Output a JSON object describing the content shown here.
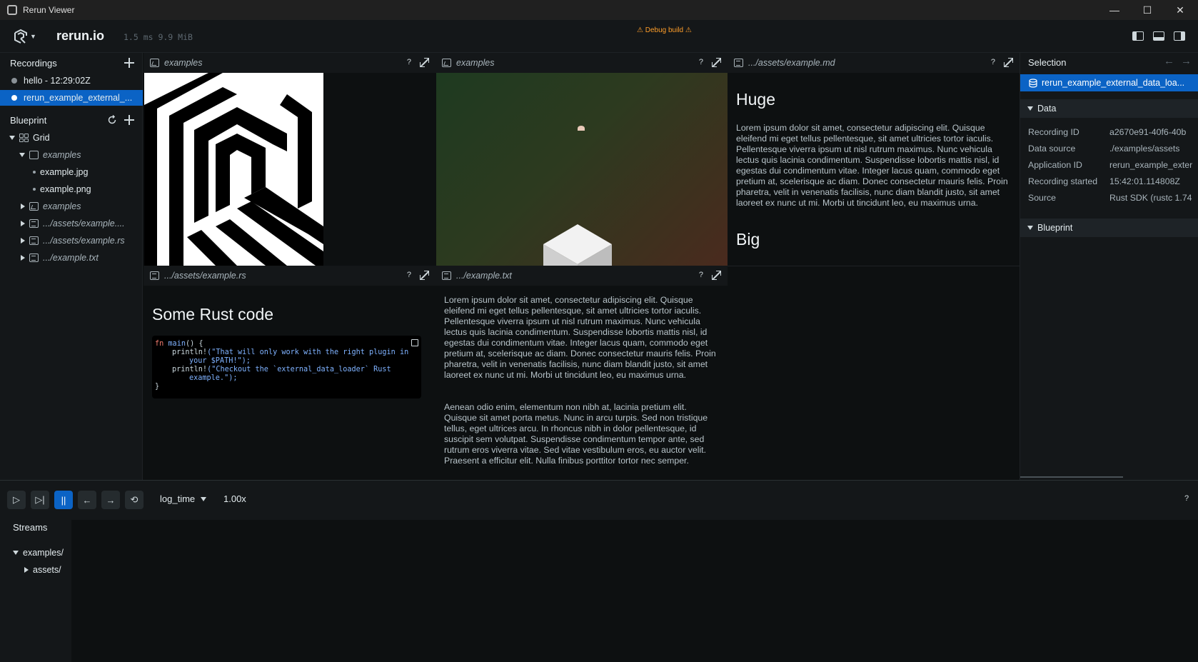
{
  "window": {
    "title": "Rerun Viewer",
    "controls": [
      "—",
      "☐",
      "✕"
    ]
  },
  "top": {
    "brand": "rerun.io",
    "stats": "1.5 ms 9.9 MiB",
    "debug_badge": "⚠ Debug build ⚠"
  },
  "recordings": {
    "header": "Recordings",
    "items": [
      {
        "label": "hello - 12:29:02Z",
        "selected": false
      },
      {
        "label": "rerun_example_external_...",
        "selected": true
      }
    ]
  },
  "blueprint": {
    "header": "Blueprint",
    "tree": {
      "grid": "Grid",
      "examples_1": "examples",
      "example_jpg": "example.jpg",
      "example_png": "example.png",
      "examples_2": "examples",
      "assets_md": ".../assets/example....",
      "assets_rs": ".../assets/example.rs",
      "example_txt": ".../example.txt"
    }
  },
  "views": {
    "v1": {
      "title": "examples",
      "help": "?"
    },
    "v2": {
      "title": "examples",
      "help": "?"
    },
    "v3": {
      "title": ".../assets/example.md",
      "help": "?",
      "h1": "Huge",
      "para": "Lorem ipsum dolor sit amet, consectetur adipiscing elit. Quisque eleifend mi eget tellus pellentesque, sit amet ultricies tortor iaculis. Pellentesque viverra ipsum ut nisl rutrum maximus. Nunc vehicula lectus quis lacinia condimentum. Suspendisse lobortis mattis nisl, id egestas dui condimentum vitae. Integer lacus quam, commodo eget pretium at, scelerisque ac diam. Donec consectetur mauris felis. Proin pharetra, velit in venenatis facilisis, nunc diam blandit justo, sit amet laoreet ex nunc ut mi. Morbi ut tincidunt leo, eu maximus urna.",
      "h2": "Big"
    },
    "v4": {
      "title": ".../assets/example.rs",
      "help": "?",
      "h1": "Some Rust code",
      "code": {
        "l1_kw": "fn",
        "l1_fn": "main",
        "l1_rest": "() {",
        "l2_macro": "println!",
        "l2_str": "(\"That will only work with the right plugin in your $PATH!\");",
        "l3_macro": "println!",
        "l3_str": "(\"Checkout the `external_data_loader` Rust example.\");",
        "l4": "}"
      }
    },
    "v5": {
      "title": ".../example.txt",
      "help": "?",
      "p1": "Lorem ipsum dolor sit amet, consectetur adipiscing elit. Quisque eleifend mi eget tellus pellentesque, sit amet ultricies tortor iaculis. Pellentesque viverra ipsum ut nisl rutrum maximus. Nunc vehicula lectus quis lacinia condimentum. Suspendisse lobortis mattis nisl, id egestas dui condimentum vitae. Integer lacus quam, commodo eget pretium at, scelerisque ac diam. Donec consectetur mauris felis. Proin pharetra, velit in venenatis facilisis, nunc diam blandit justo, sit amet laoreet ex nunc ut mi. Morbi ut tincidunt leo, eu maximus urna.",
      "p2": "Aenean odio enim, elementum non nibh at, lacinia pretium elit. Quisque sit amet porta metus. Nunc in arcu turpis. Sed non tristique tellus, eget ultrices arcu. In rhoncus nibh in dolor pellentesque, id suscipit sem volutpat. Suspendisse condimentum tempor ante, sed rutrum eros viverra vitae. Sed vitae vestibulum eros, eu auctor velit. Praesent a efficitur elit. Nulla finibus porttitor tortor nec semper."
    }
  },
  "selection": {
    "header": "Selection",
    "item": "rerun_example_external_data_loa...",
    "data_section": "Data",
    "rows": [
      {
        "key": "Recording ID",
        "value": "a2670e91-40f6-40b"
      },
      {
        "key": "Data source",
        "value": "./examples/assets"
      },
      {
        "key": "Application ID",
        "value": "rerun_example_exter"
      },
      {
        "key": "Recording started",
        "value": "15:42:01.114808Z"
      },
      {
        "key": "Source",
        "value": "Rust SDK (rustc 1.74"
      }
    ],
    "blueprint_section": "Blueprint"
  },
  "timeline": {
    "timeline_name": "log_time",
    "speed": "1.00x",
    "help": "?",
    "streams_header": "Streams",
    "streams": [
      {
        "label": "examples/",
        "expanded": true
      },
      {
        "label": "assets/",
        "expanded": false
      }
    ]
  },
  "colors": {
    "accent": "#0b63c5",
    "debug": "#ff9e2a",
    "background": "#0d1011",
    "panel": "#141719"
  }
}
